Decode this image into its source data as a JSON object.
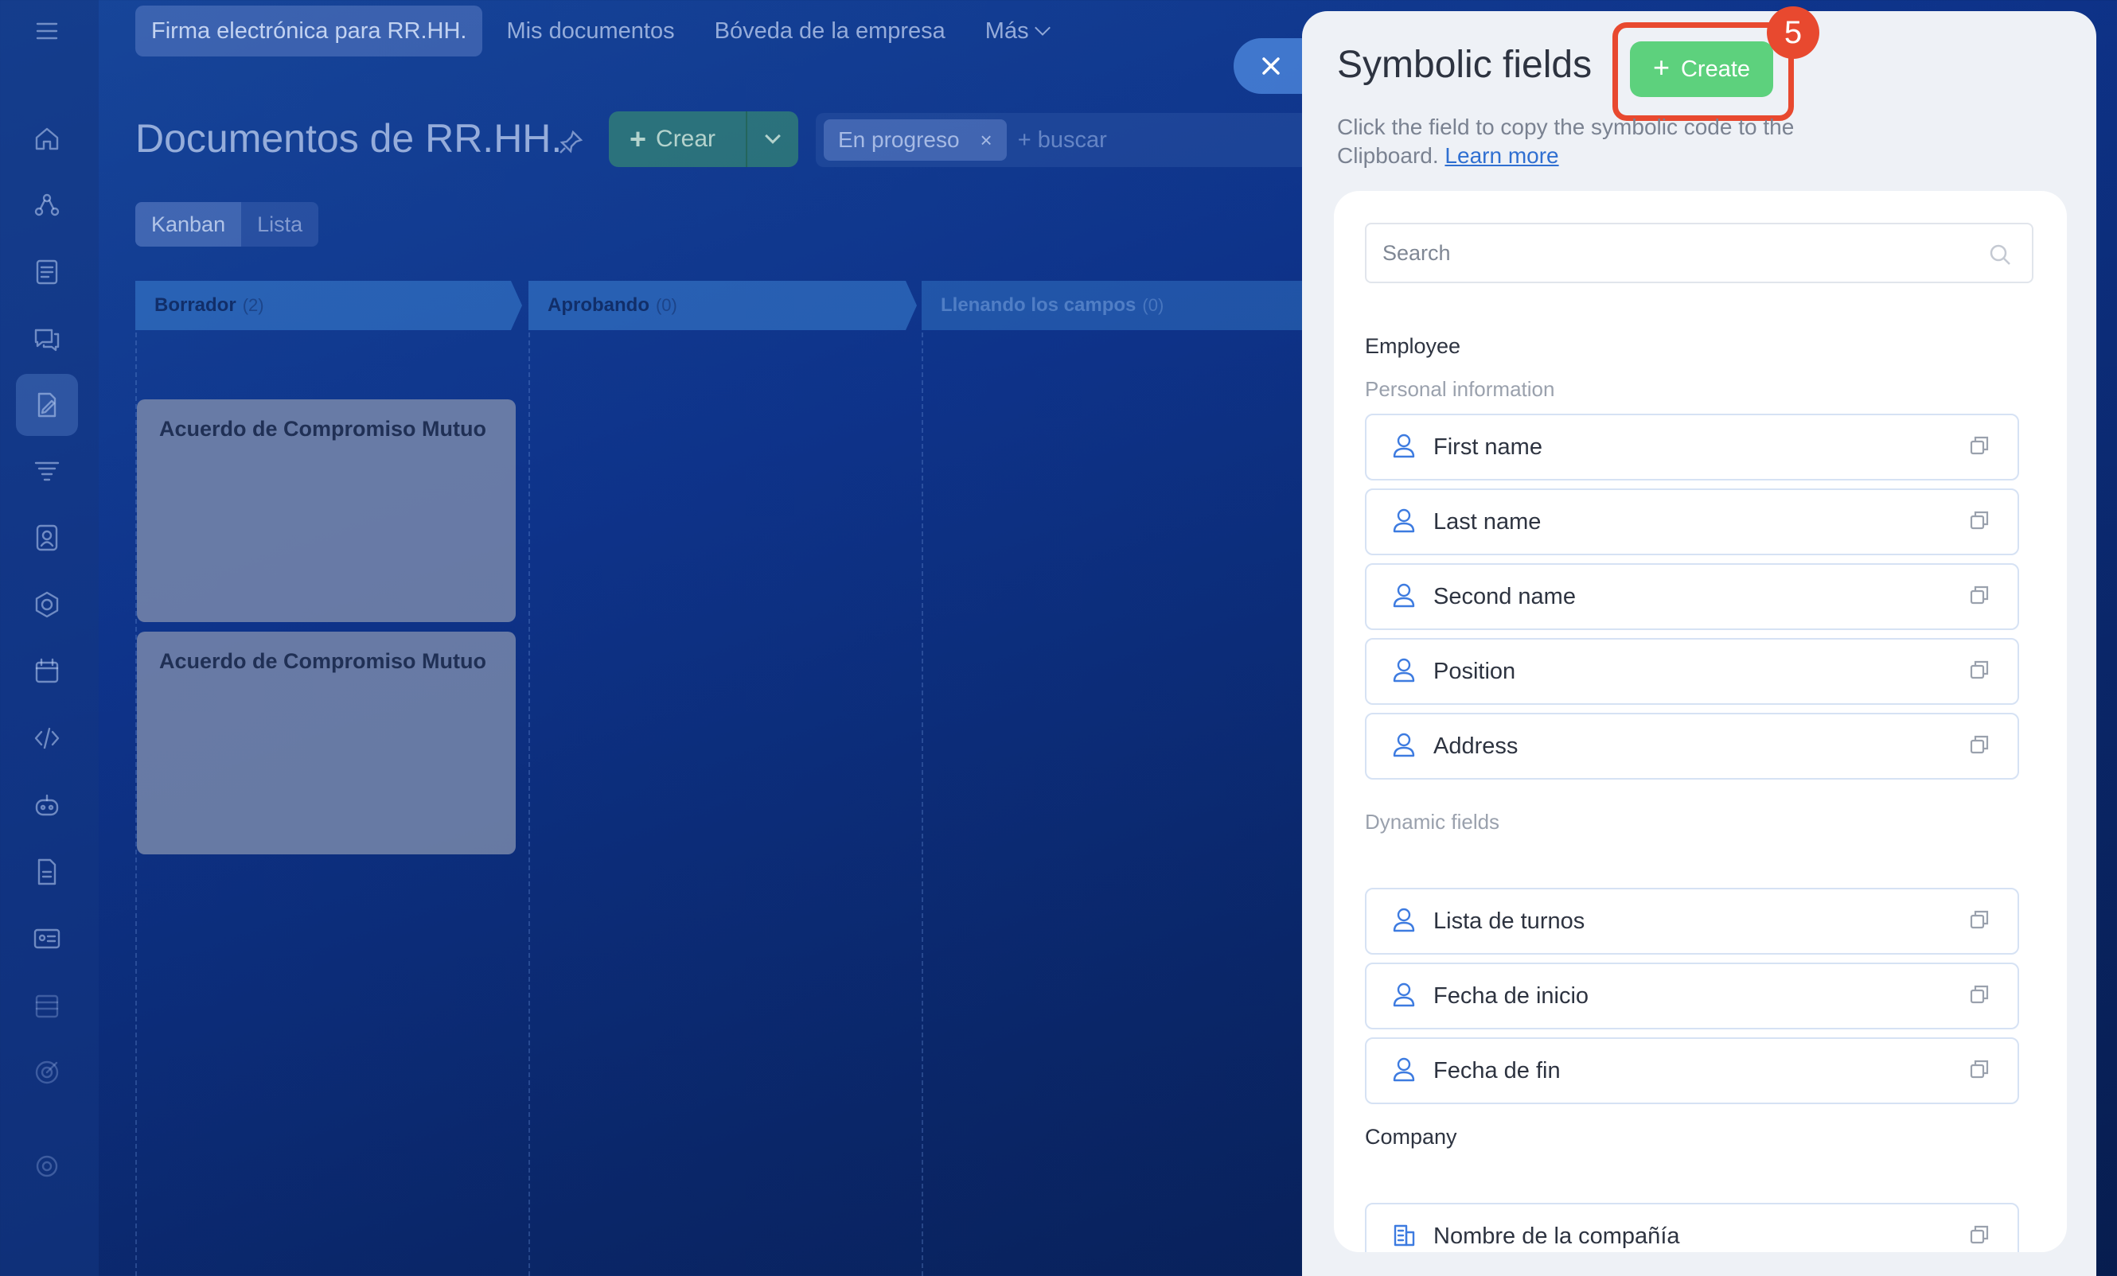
{
  "topnav": {
    "tabs": [
      {
        "label": "Firma electrónica para RR.HH."
      },
      {
        "label": "Mis documentos"
      },
      {
        "label": "Bóveda de la empresa"
      },
      {
        "label": "Más"
      }
    ]
  },
  "sidebar": {
    "icons": [
      "menu-icon",
      "home-icon",
      "workflow-icon",
      "feed-icon",
      "chat-icon",
      "sign-icon",
      "filter-icon",
      "contact-icon",
      "hexagon-icon",
      "calendar-icon",
      "code-icon",
      "robot-icon",
      "document-icon",
      "id-card-icon",
      "inbox-icon",
      "target-icon",
      "settings-icon"
    ]
  },
  "page": {
    "title": "Documentos de RR.HH.",
    "create_label": "Crear",
    "filter_chip": "En progreso",
    "filter_chip_close": "×",
    "search_placeholder": "+ buscar",
    "views": [
      "Kanban",
      "Lista"
    ]
  },
  "kanban": {
    "columns": [
      {
        "name": "Borrador",
        "count": "(2)"
      },
      {
        "name": "Aprobando",
        "count": "(0)"
      },
      {
        "name": "Llenando los campos",
        "count": "(0)"
      }
    ],
    "cards": [
      {
        "title": "Acuerdo de Compromiso Mutuo"
      },
      {
        "title": "Acuerdo de Compromiso Mutuo"
      }
    ]
  },
  "panel": {
    "title": "Symbolic fields",
    "create_label": "Create",
    "step_badge": "5",
    "description": "Click the field to copy the symbolic code to the Clipboard.",
    "learn_more": "Learn more",
    "search_placeholder": "Search",
    "sections": {
      "employee": "Employee",
      "personal": "Personal information",
      "dynamic": "Dynamic fields",
      "company": "Company"
    },
    "personal_fields": [
      "First name",
      "Last name",
      "Second name",
      "Position",
      "Address"
    ],
    "dynamic_fields": [
      "Lista de turnos",
      "Fecha de inicio",
      "Fecha de fin"
    ],
    "company_fields": [
      "Nombre de la compañía"
    ]
  },
  "colors": {
    "create_green": "#5dd17d",
    "highlight_red": "#e8492f",
    "link_blue": "#2f6fd1"
  }
}
